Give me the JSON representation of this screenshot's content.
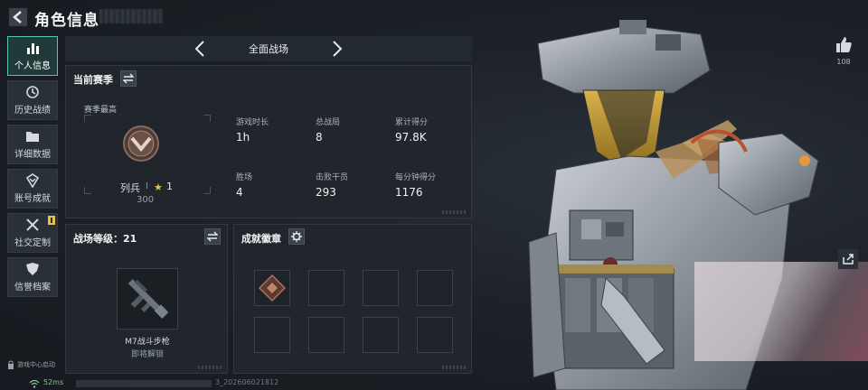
{
  "header": {
    "title": "角色信息"
  },
  "sidebar": {
    "items": [
      {
        "label": "个人信息",
        "icon": "bar-chart-icon",
        "active": true
      },
      {
        "label": "历史战绩",
        "icon": "history-icon"
      },
      {
        "label": "详细数据",
        "icon": "folder-icon"
      },
      {
        "label": "账号成就",
        "icon": "achievement-icon"
      },
      {
        "label": "社交定制",
        "icon": "tools-icon",
        "badge": true
      },
      {
        "label": "信誉档案",
        "icon": "shield-icon"
      }
    ],
    "game_center": "游戏中心启动"
  },
  "mode_switch": {
    "label": "全面战场"
  },
  "season_panel": {
    "title": "当前赛季",
    "subtitle": "赛季最高",
    "rank_name": "列兵",
    "rank_sep": "I",
    "star_icon": "star-icon",
    "rank_level": "1",
    "rank_points": "300",
    "stats": [
      {
        "label": "游戏时长",
        "value": "1h"
      },
      {
        "label": "总战局",
        "value": "8"
      },
      {
        "label": "累计得分",
        "value": "97.8K"
      },
      {
        "label": "胜场",
        "value": "4"
      },
      {
        "label": "击败干员",
        "value": "293"
      },
      {
        "label": "每分钟得分",
        "value": "1176"
      }
    ]
  },
  "battlefield_panel": {
    "title": "战场等级：21",
    "weapon_name": "M7战斗步枪",
    "weapon_status": "即将解锁"
  },
  "medals_panel": {
    "title": "成就徽章"
  },
  "like": {
    "count": "108"
  },
  "footer": {
    "ping": "52ms",
    "uid_suffix": "3_20260602181​2"
  },
  "colors": {
    "accent": "#4fc7b7",
    "star": "#e7c24d",
    "panel": "#20262c"
  }
}
